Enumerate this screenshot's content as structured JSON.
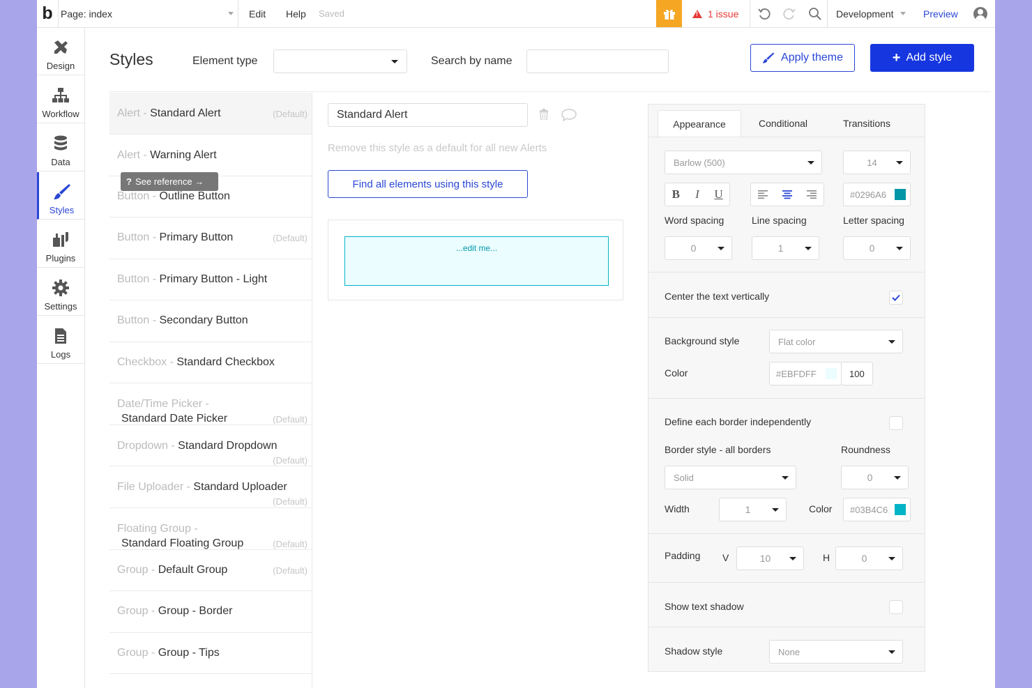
{
  "topbar": {
    "logo": "b",
    "page_label": "Page: index",
    "menu_edit": "Edit",
    "menu_help": "Help",
    "saved": "Saved",
    "issues": "1 issue",
    "environment": "Development",
    "preview": "Preview"
  },
  "nav": {
    "items": [
      {
        "label": "Design"
      },
      {
        "label": "Workflow"
      },
      {
        "label": "Data"
      },
      {
        "label": "Styles"
      },
      {
        "label": "Plugins"
      },
      {
        "label": "Settings"
      },
      {
        "label": "Logs"
      }
    ],
    "tooltip": "See reference →"
  },
  "header": {
    "title": "Styles",
    "element_type_label": "Element type",
    "search_label": "Search by name",
    "apply_theme": "Apply theme",
    "add_style": "Add style"
  },
  "style_list": [
    {
      "category": "Alert -",
      "name": "Standard Alert",
      "default": "(Default)"
    },
    {
      "category": "Alert -",
      "name": "Warning Alert",
      "default": ""
    },
    {
      "category": "Button -",
      "name": "Outline Button",
      "default": ""
    },
    {
      "category": "Button -",
      "name": "Primary Button",
      "default": "(Default)"
    },
    {
      "category": "Button -",
      "name": "Primary Button - Light",
      "default": ""
    },
    {
      "category": "Button -",
      "name": "Secondary Button",
      "default": ""
    },
    {
      "category": "Checkbox -",
      "name": "Standard Checkbox",
      "default": ""
    },
    {
      "category": "Date/Time Picker -",
      "name": "Standard Date Picker",
      "default": "(Default)"
    },
    {
      "category": "Dropdown -",
      "name": "Standard Dropdown",
      "default": "(Default)"
    },
    {
      "category": "File Uploader -",
      "name": "Standard Uploader",
      "default": "(Default)"
    },
    {
      "category": "Floating Group -",
      "name": "Standard Floating Group",
      "default": "(Default)"
    },
    {
      "category": "Group -",
      "name": "Default Group",
      "default": "(Default)"
    },
    {
      "category": "Group -",
      "name": "Group - Border",
      "default": ""
    },
    {
      "category": "Group -",
      "name": "Group - Tips",
      "default": ""
    }
  ],
  "editor": {
    "style_name": "Standard Alert",
    "remove_default": "Remove this style as a default for all new Alerts",
    "find_elements": "Find all elements using this style",
    "preview_text": "...edit me..."
  },
  "props": {
    "tabs": [
      "Appearance",
      "Conditional",
      "Transitions"
    ],
    "font": "Barlow (500)",
    "font_size": "14",
    "font_color": "#0296A6",
    "word_spacing_label": "Word spacing",
    "line_spacing_label": "Line spacing",
    "letter_spacing_label": "Letter spacing",
    "word_spacing": "0",
    "line_spacing": "1",
    "letter_spacing": "0",
    "center_vertically_label": "Center the text vertically",
    "center_vertically": true,
    "bg_style_label": "Background style",
    "bg_style": "Flat color",
    "color_label": "Color",
    "bg_color": "#EBFDFF",
    "bg_opacity": "100",
    "border_independent_label": "Define each border independently",
    "border_style_label": "Border style - all borders",
    "roundness_label": "Roundness",
    "border_style": "Solid",
    "roundness": "0",
    "width_label": "Width",
    "border_width": "1",
    "border_color_label": "Color",
    "border_color": "#03B4C6",
    "padding_label": "Padding",
    "padding_v_label": "V",
    "padding_v": "10",
    "padding_h_label": "H",
    "padding_h": "0",
    "text_shadow_label": "Show text shadow",
    "shadow_style_label": "Shadow style",
    "shadow_style": "None"
  },
  "colors": {
    "accent": "#2B47D6",
    "primary_button": "#1636E0",
    "gift": "#F5A623",
    "issue": "#E53935",
    "preview_bg": "#EBFDFF",
    "preview_border": "#03B4C6",
    "font_color": "#0296A6"
  }
}
